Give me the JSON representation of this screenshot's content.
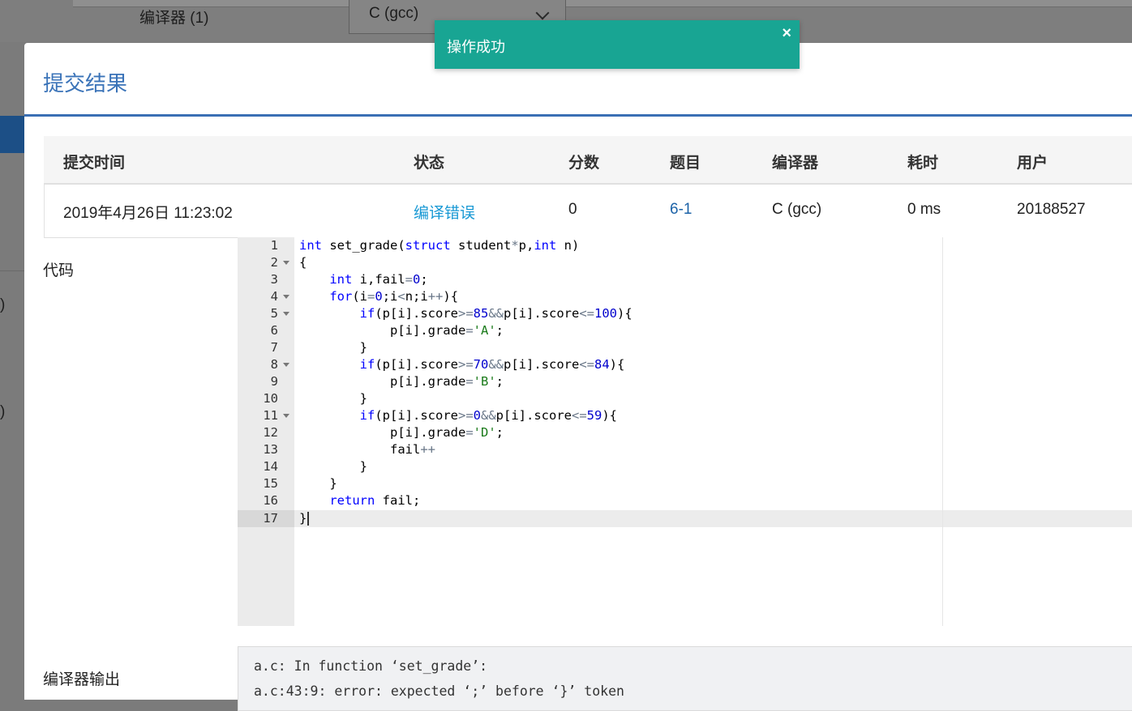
{
  "background": {
    "compiler_label": "编译器 (1)",
    "compiler_select_value": "C (gcc)",
    "side_marks": [
      ")",
      ")"
    ]
  },
  "modal": {
    "title": "提交结果",
    "table": {
      "headers": [
        "提交时间",
        "状态",
        "分数",
        "题目",
        "编译器",
        "耗时",
        "用户"
      ],
      "row": {
        "time": "2019年4月26日 11:23:02",
        "status": "编译错误",
        "score": "0",
        "problem": "6-1",
        "compiler": "C (gcc)",
        "duration": "0 ms",
        "user": "20188527"
      }
    },
    "code_label": "代码",
    "compiler_output_label": "编译器输出",
    "compiler_output_lines": [
      "a.c: In function ‘set_grade’:",
      "a.c:43:9: error: expected ‘;’ before ‘}’ token"
    ]
  },
  "code": {
    "line_numbers": [
      "1",
      "2",
      "3",
      "4",
      "5",
      "6",
      "7",
      "8",
      "9",
      "10",
      "11",
      "12",
      "13",
      "14",
      "15",
      "16",
      "17"
    ],
    "active_line": 17
  },
  "toast": {
    "message": "操作成功",
    "close_icon": "close-icon",
    "color": "#18a593"
  },
  "colors": {
    "accent": "#3a73b8",
    "status_link": "#1798d4"
  }
}
